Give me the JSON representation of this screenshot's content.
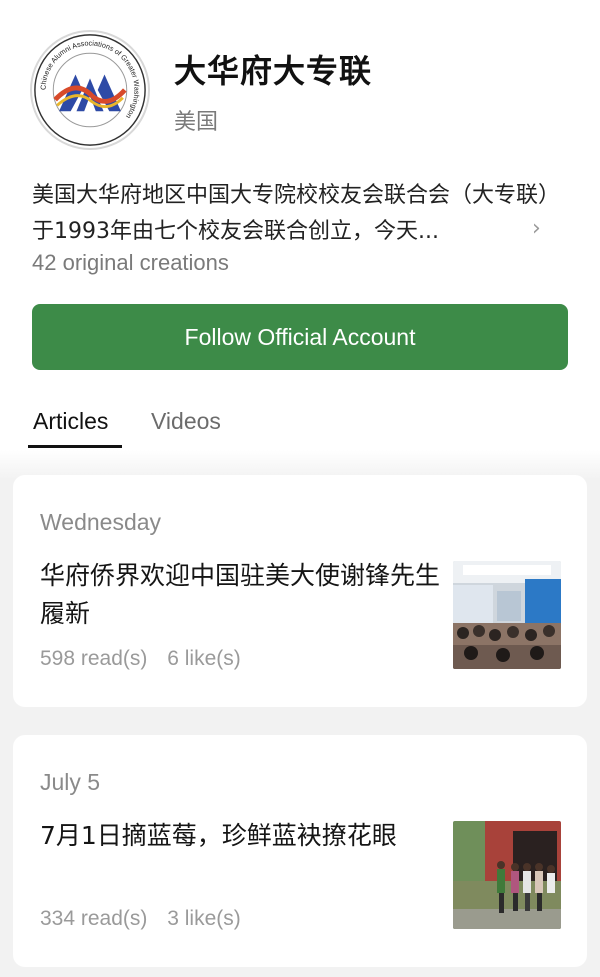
{
  "account": {
    "name": "大华府大专联",
    "region": "美国",
    "logo_ring_text": "Chinese Alumni Associations of Greater Washington",
    "description": "美国大华府地区中国大专院校校友会联合会（大专联）于1993年由七个校友会联合创立，今天...",
    "creations": "42 original creations",
    "follow_label": "Follow Official Account"
  },
  "tabs": [
    {
      "label": "Articles",
      "active": true
    },
    {
      "label": "Videos",
      "active": false
    }
  ],
  "articles": [
    {
      "date": "Wednesday",
      "title": "华府侨界欢迎中国驻美大使谢锋先生履新",
      "reads": "598 read(s)",
      "likes": "6 like(s)",
      "thumbnail": "conference-hall-photo"
    },
    {
      "date": "July 5",
      "title": "7月1日摘蓝莓，珍鲜蓝袂撩花眼",
      "reads": "334 read(s)",
      "likes": "3 like(s)",
      "thumbnail": "farm-group-photo"
    }
  ],
  "colors": {
    "follow_button": "#3d8b48",
    "feed_background": "#f2f2f2",
    "logo_blue": "#2e4aa6",
    "logo_red": "#d84a2a",
    "logo_yellow": "#e9b62a"
  }
}
